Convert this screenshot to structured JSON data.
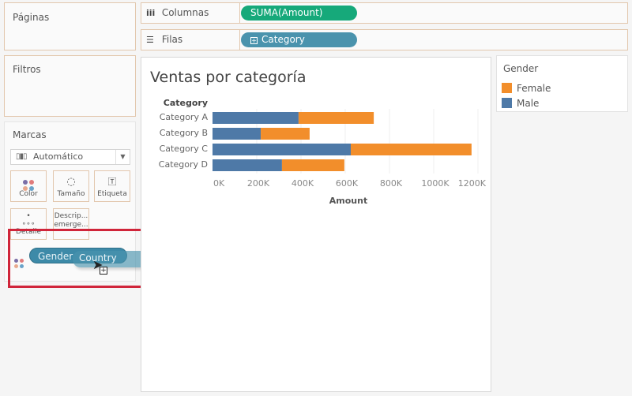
{
  "shelves": {
    "pages_label": "Páginas",
    "filters_label": "Filtros",
    "columns": {
      "label": "Columnas",
      "icon": "columns-icon",
      "pill": "SUMA(Amount)"
    },
    "rows": {
      "label": "Filas",
      "icon": "rows-icon",
      "pill": "Category"
    }
  },
  "marks": {
    "title": "Marcas",
    "mark_type": "Automático",
    "buttons": [
      {
        "label": "Color",
        "icon": "color-icon"
      },
      {
        "label": "Tamaño",
        "icon": "size-icon"
      },
      {
        "label": "Etiqueta",
        "icon": "label-icon"
      },
      {
        "label": "Detalle",
        "icon": "detail-icon"
      },
      {
        "label": "Descrip... emerge...",
        "icon": "tooltip-icon"
      }
    ],
    "color_field_pill": "Gender",
    "dragging_pill": "Country"
  },
  "colors": {
    "female": "#f28e2b",
    "male": "#4e79a7",
    "columns_pill": "#16a97a",
    "rows_pill": "#4a93ad",
    "highlight": "#d0253a"
  },
  "legend": {
    "title": "Gender",
    "items": [
      {
        "label": "Female",
        "color": "#f28e2b"
      },
      {
        "label": "Male",
        "color": "#4e79a7"
      }
    ]
  },
  "chart_data": {
    "type": "bar",
    "orientation": "horizontal",
    "stacked": true,
    "title": "Ventas por categoría",
    "row_header": "Category",
    "categories": [
      "Category A",
      "Category B",
      "Category C",
      "Category D"
    ],
    "series": [
      {
        "name": "Male",
        "color": "#4e79a7",
        "values": [
          389000,
          218000,
          625000,
          314000
        ]
      },
      {
        "name": "Female",
        "color": "#f28e2b",
        "values": [
          340000,
          221000,
          546000,
          282000
        ]
      }
    ],
    "xlabel": "Amount",
    "ylabel": "",
    "xlim": [
      0,
      1200000
    ],
    "xticks": [
      0,
      200000,
      400000,
      600000,
      800000,
      1000000,
      1200000
    ],
    "xtick_labels": [
      "0K",
      "200K",
      "400K",
      "600K",
      "800K",
      "1000K",
      "1200K"
    ],
    "grid": true,
    "legend": "right"
  }
}
